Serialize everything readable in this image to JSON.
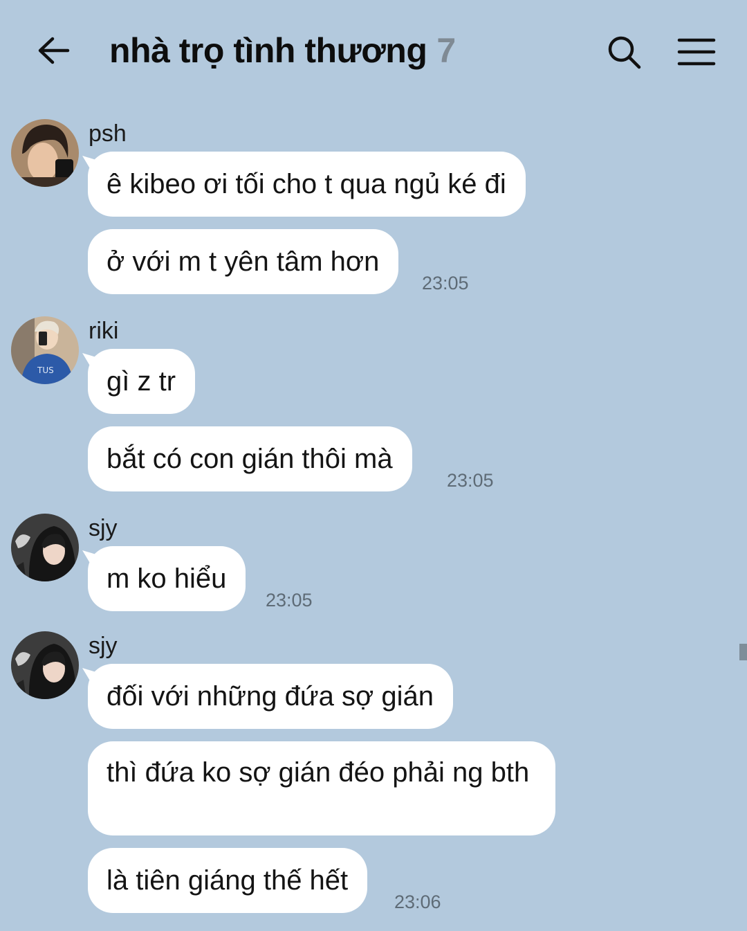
{
  "header": {
    "title": "nhà trọ tình thương",
    "member_count": "7",
    "icons": [
      "arrow-left-icon",
      "search-icon",
      "menu-icon"
    ]
  },
  "colors": {
    "background": "#b3c9dd",
    "bubble": "#ffffff",
    "timestamp": "#5e6b76",
    "count": "#7f8a94"
  },
  "messages": [
    {
      "sender": "psh",
      "lines": [
        "ê kibeo ơi tối cho t qua ngủ ké đi",
        "ở với m t yên tâm hơn"
      ],
      "time": "23:05"
    },
    {
      "sender": "riki",
      "lines": [
        "gì z tr",
        "bắt có con gián thôi mà"
      ],
      "time": "23:05"
    },
    {
      "sender": "sjy",
      "lines": [
        "m ko hiểu"
      ],
      "time": "23:05"
    },
    {
      "sender": "sjy",
      "lines": [
        "đối với những đứa sợ gián",
        "thì đứa ko sợ gián đéo phải ng bth",
        "là tiên giáng thế hết"
      ],
      "time": "23:06"
    }
  ]
}
